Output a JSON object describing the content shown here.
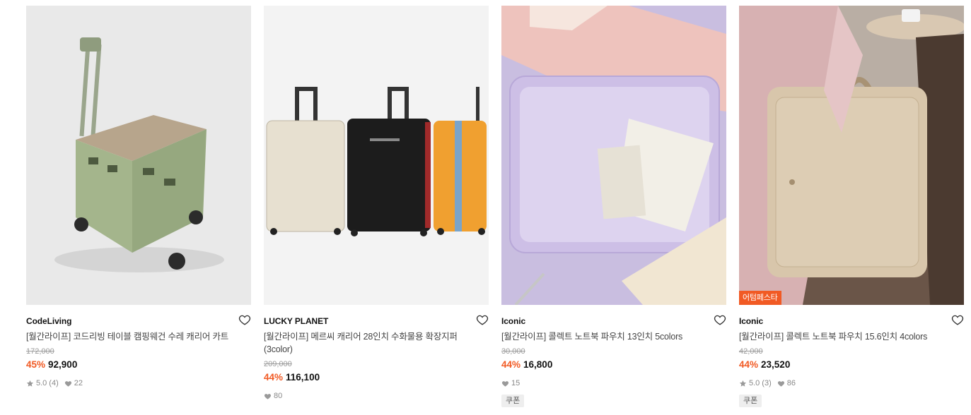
{
  "products": [
    {
      "brand": "CodeLiving",
      "title": "[월간라이프] 코드리빙 테이블 캠핑웨건 수레 캐리어 카트",
      "original_price": "172,000",
      "discount": "45%",
      "price": "92,900",
      "rating": "5.0",
      "review_count": "(4)",
      "likes": "22",
      "image": "green-folding-cart"
    },
    {
      "brand": "LUCKY PLANET",
      "title": "[월간라이프] 메르씨 캐리어 28인치 수화물용 확장지퍼 (3color)",
      "original_price": "209,000",
      "discount": "44%",
      "price": "116,100",
      "likes": "80",
      "image": "three-suitcases"
    },
    {
      "brand": "Iconic",
      "title": "[월간라이프] 콜렉트 노트북 파우치 13인치 5colors",
      "original_price": "30,000",
      "discount": "44%",
      "price": "16,800",
      "likes": "15",
      "coupon": "쿠폰",
      "image": "lavender-laptop-pouch"
    },
    {
      "brand": "Iconic",
      "title": "[월간라이프] 콜렉트 노트북 파우치 15.6인치 4colors",
      "original_price": "42,000",
      "discount": "44%",
      "price": "23,520",
      "rating": "5.0",
      "review_count": "(3)",
      "likes": "86",
      "coupon": "쿠폰",
      "badge": "어텀페스타",
      "image": "beige-laptop-pouch"
    }
  ],
  "colors": {
    "accent": "#f15a24",
    "strike": "#9a9a9a"
  },
  "icons": [
    "heart-outline-icon",
    "star-icon",
    "heart-filled-icon"
  ]
}
